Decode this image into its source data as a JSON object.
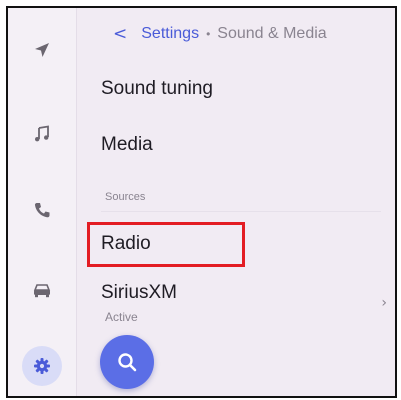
{
  "breadcrumb": {
    "back_glyph": "<",
    "parent": "Settings",
    "separator": "•",
    "current": "Sound & Media"
  },
  "list": {
    "sound_tuning": "Sound tuning",
    "media": "Media",
    "sources_label": "Sources",
    "radio": "Radio",
    "siriusxm": "SiriusXM",
    "siriusxm_status": "Active",
    "chevron": "›"
  },
  "rail": {
    "items": [
      {
        "icon": "navigation-icon"
      },
      {
        "icon": "music-note-icon"
      },
      {
        "icon": "phone-icon"
      },
      {
        "icon": "car-icon"
      },
      {
        "icon": "settings-gear-icon",
        "active": true
      }
    ]
  },
  "colors": {
    "accent": "#4a5bd8",
    "fab": "#5b6ee6",
    "highlight_box": "#e31c23",
    "background": "#f1ebf3"
  }
}
